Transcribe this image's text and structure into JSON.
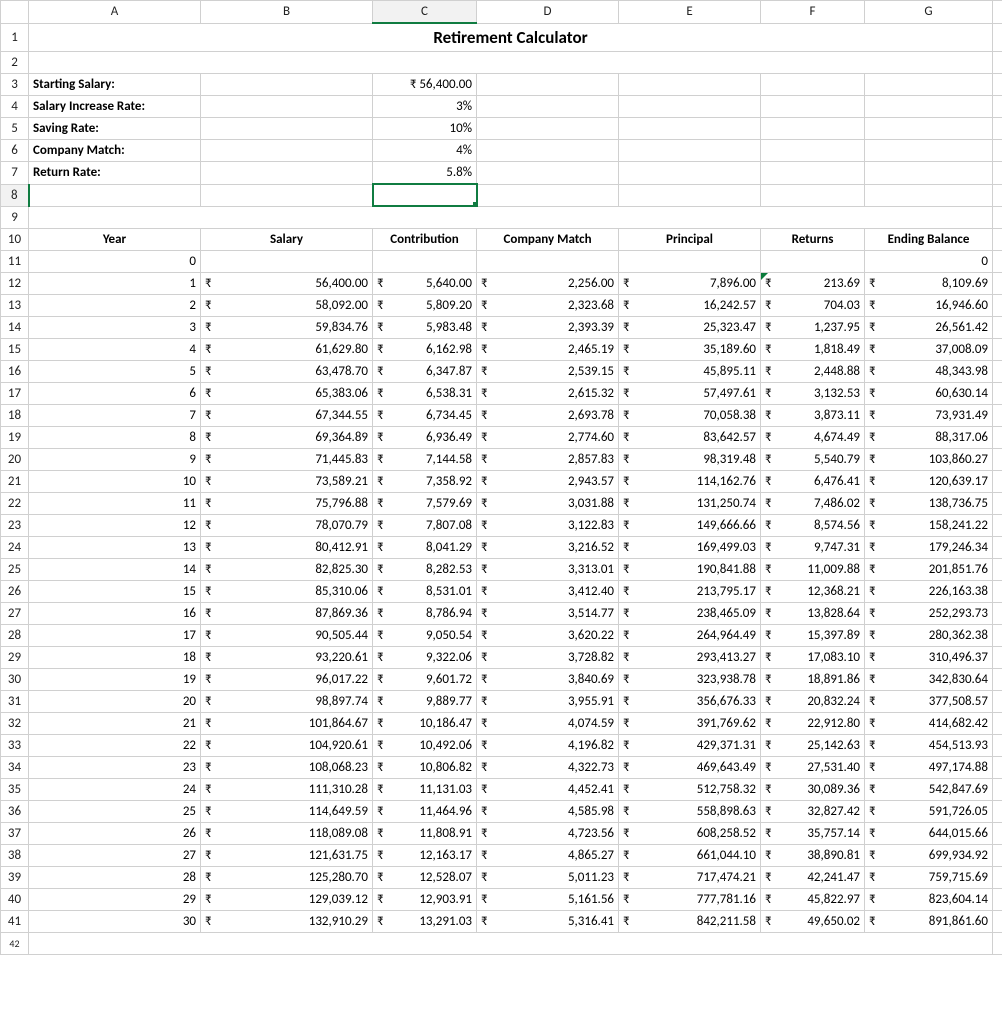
{
  "title": "Retirement Calculator",
  "columns": [
    "",
    "A",
    "B",
    "C",
    "D",
    "E",
    "F",
    "G"
  ],
  "selected_cell": "C8",
  "params": {
    "starting_salary": {
      "label": "Starting Salary:",
      "value": "₹   56,400.00"
    },
    "salary_increase": {
      "label": "Salary Increase Rate:",
      "value": "3%"
    },
    "saving_rate": {
      "label": "Saving Rate:",
      "value": "10%"
    },
    "company_match": {
      "label": "Company Match:",
      "value": "4%"
    },
    "return_rate": {
      "label": "Return Rate:",
      "value": "5.8%"
    }
  },
  "headers": {
    "year": "Year",
    "salary": "Salary",
    "contribution": "Contribution",
    "company_match": "Company Match",
    "principal": "Principal",
    "returns": "Returns",
    "ending_balance": "Ending Balance"
  },
  "currency_symbol": "₹",
  "initial": {
    "year": "0",
    "ending_balance": "0"
  },
  "rows": [
    {
      "year": "1",
      "salary": "56,400.00",
      "contribution": "5,640.00",
      "cmatch": "2,256.00",
      "principal": "7,896.00",
      "returns": "213.69",
      "ending": "8,109.69"
    },
    {
      "year": "2",
      "salary": "58,092.00",
      "contribution": "5,809.20",
      "cmatch": "2,323.68",
      "principal": "16,242.57",
      "returns": "704.03",
      "ending": "16,946.60"
    },
    {
      "year": "3",
      "salary": "59,834.76",
      "contribution": "5,983.48",
      "cmatch": "2,393.39",
      "principal": "25,323.47",
      "returns": "1,237.95",
      "ending": "26,561.42"
    },
    {
      "year": "4",
      "salary": "61,629.80",
      "contribution": "6,162.98",
      "cmatch": "2,465.19",
      "principal": "35,189.60",
      "returns": "1,818.49",
      "ending": "37,008.09"
    },
    {
      "year": "5",
      "salary": "63,478.70",
      "contribution": "6,347.87",
      "cmatch": "2,539.15",
      "principal": "45,895.11",
      "returns": "2,448.88",
      "ending": "48,343.98"
    },
    {
      "year": "6",
      "salary": "65,383.06",
      "contribution": "6,538.31",
      "cmatch": "2,615.32",
      "principal": "57,497.61",
      "returns": "3,132.53",
      "ending": "60,630.14"
    },
    {
      "year": "7",
      "salary": "67,344.55",
      "contribution": "6,734.45",
      "cmatch": "2,693.78",
      "principal": "70,058.38",
      "returns": "3,873.11",
      "ending": "73,931.49"
    },
    {
      "year": "8",
      "salary": "69,364.89",
      "contribution": "6,936.49",
      "cmatch": "2,774.60",
      "principal": "83,642.57",
      "returns": "4,674.49",
      "ending": "88,317.06"
    },
    {
      "year": "9",
      "salary": "71,445.83",
      "contribution": "7,144.58",
      "cmatch": "2,857.83",
      "principal": "98,319.48",
      "returns": "5,540.79",
      "ending": "103,860.27"
    },
    {
      "year": "10",
      "salary": "73,589.21",
      "contribution": "7,358.92",
      "cmatch": "2,943.57",
      "principal": "114,162.76",
      "returns": "6,476.41",
      "ending": "120,639.17"
    },
    {
      "year": "11",
      "salary": "75,796.88",
      "contribution": "7,579.69",
      "cmatch": "3,031.88",
      "principal": "131,250.74",
      "returns": "7,486.02",
      "ending": "138,736.75"
    },
    {
      "year": "12",
      "salary": "78,070.79",
      "contribution": "7,807.08",
      "cmatch": "3,122.83",
      "principal": "149,666.66",
      "returns": "8,574.56",
      "ending": "158,241.22"
    },
    {
      "year": "13",
      "salary": "80,412.91",
      "contribution": "8,041.29",
      "cmatch": "3,216.52",
      "principal": "169,499.03",
      "returns": "9,747.31",
      "ending": "179,246.34"
    },
    {
      "year": "14",
      "salary": "82,825.30",
      "contribution": "8,282.53",
      "cmatch": "3,313.01",
      "principal": "190,841.88",
      "returns": "11,009.88",
      "ending": "201,851.76"
    },
    {
      "year": "15",
      "salary": "85,310.06",
      "contribution": "8,531.01",
      "cmatch": "3,412.40",
      "principal": "213,795.17",
      "returns": "12,368.21",
      "ending": "226,163.38"
    },
    {
      "year": "16",
      "salary": "87,869.36",
      "contribution": "8,786.94",
      "cmatch": "3,514.77",
      "principal": "238,465.09",
      "returns": "13,828.64",
      "ending": "252,293.73"
    },
    {
      "year": "17",
      "salary": "90,505.44",
      "contribution": "9,050.54",
      "cmatch": "3,620.22",
      "principal": "264,964.49",
      "returns": "15,397.89",
      "ending": "280,362.38"
    },
    {
      "year": "18",
      "salary": "93,220.61",
      "contribution": "9,322.06",
      "cmatch": "3,728.82",
      "principal": "293,413.27",
      "returns": "17,083.10",
      "ending": "310,496.37"
    },
    {
      "year": "19",
      "salary": "96,017.22",
      "contribution": "9,601.72",
      "cmatch": "3,840.69",
      "principal": "323,938.78",
      "returns": "18,891.86",
      "ending": "342,830.64"
    },
    {
      "year": "20",
      "salary": "98,897.74",
      "contribution": "9,889.77",
      "cmatch": "3,955.91",
      "principal": "356,676.33",
      "returns": "20,832.24",
      "ending": "377,508.57"
    },
    {
      "year": "21",
      "salary": "101,864.67",
      "contribution": "10,186.47",
      "cmatch": "4,074.59",
      "principal": "391,769.62",
      "returns": "22,912.80",
      "ending": "414,682.42"
    },
    {
      "year": "22",
      "salary": "104,920.61",
      "contribution": "10,492.06",
      "cmatch": "4,196.82",
      "principal": "429,371.31",
      "returns": "25,142.63",
      "ending": "454,513.93"
    },
    {
      "year": "23",
      "salary": "108,068.23",
      "contribution": "10,806.82",
      "cmatch": "4,322.73",
      "principal": "469,643.49",
      "returns": "27,531.40",
      "ending": "497,174.88"
    },
    {
      "year": "24",
      "salary": "111,310.28",
      "contribution": "11,131.03",
      "cmatch": "4,452.41",
      "principal": "512,758.32",
      "returns": "30,089.36",
      "ending": "542,847.69"
    },
    {
      "year": "25",
      "salary": "114,649.59",
      "contribution": "11,464.96",
      "cmatch": "4,585.98",
      "principal": "558,898.63",
      "returns": "32,827.42",
      "ending": "591,726.05"
    },
    {
      "year": "26",
      "salary": "118,089.08",
      "contribution": "11,808.91",
      "cmatch": "4,723.56",
      "principal": "608,258.52",
      "returns": "35,757.14",
      "ending": "644,015.66"
    },
    {
      "year": "27",
      "salary": "121,631.75",
      "contribution": "12,163.17",
      "cmatch": "4,865.27",
      "principal": "661,044.10",
      "returns": "38,890.81",
      "ending": "699,934.92"
    },
    {
      "year": "28",
      "salary": "125,280.70",
      "contribution": "12,528.07",
      "cmatch": "5,011.23",
      "principal": "717,474.21",
      "returns": "42,241.47",
      "ending": "759,715.69"
    },
    {
      "year": "29",
      "salary": "129,039.12",
      "contribution": "12,903.91",
      "cmatch": "5,161.56",
      "principal": "777,781.16",
      "returns": "45,822.97",
      "ending": "823,604.14"
    },
    {
      "year": "30",
      "salary": "132,910.29",
      "contribution": "13,291.03",
      "cmatch": "5,316.41",
      "principal": "842,211.58",
      "returns": "49,650.02",
      "ending": "891,861.60"
    }
  ]
}
